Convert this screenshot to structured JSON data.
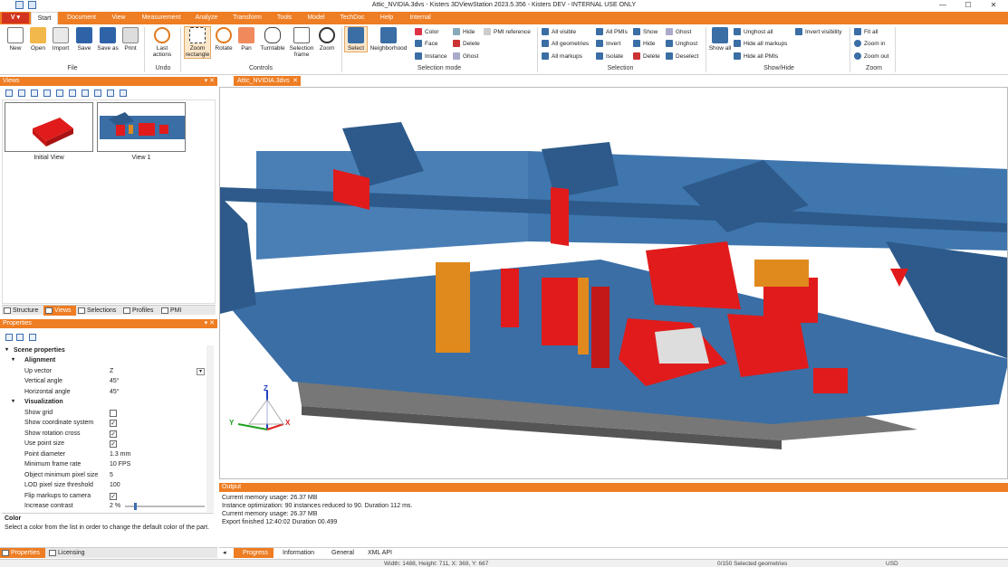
{
  "window": {
    "title": "Attic_NVIDIA.3dvs - Kisters 3DViewStation 2023.5.356 - Kisters DEV - INTERNAL USE ONLY",
    "controls": [
      "—",
      "☐",
      "✕"
    ]
  },
  "menu": {
    "app_button": "V",
    "tabs": [
      "Start",
      "Document",
      "View",
      "Measurement",
      "Analyze",
      "Transform",
      "Tools",
      "Model",
      "TechDoc",
      "Help",
      "Internal"
    ],
    "active_tab": "Start"
  },
  "ribbon": {
    "file": {
      "label": "File",
      "new": "New",
      "open": "Open",
      "import": "Import",
      "save": "Save",
      "save_as": "Save as",
      "print": "Print"
    },
    "undo": {
      "label": "Undo",
      "last_actions": "Last actions"
    },
    "controls": {
      "label": "Controls",
      "zoom_rectangle": "Zoom rectangle",
      "rotate": "Rotate",
      "pan": "Pan",
      "turntable": "Turntable",
      "selection_frame": "Selection frame",
      "zoom": "Zoom"
    },
    "selection_mode": {
      "label": "Selection mode",
      "select": "Select",
      "neighborhood": "Neighborhood",
      "color": "Color",
      "face": "Face",
      "instance": "Instance",
      "hide": "Hide",
      "delete": "Delete",
      "ghost": "Ghost",
      "pmi_reference": "PMI reference"
    },
    "selection": {
      "label": "Selection",
      "all_visible": "All visible",
      "all_geometries": "All geometries",
      "all_markups": "All markups",
      "all_pmis": "All PMIs",
      "invert": "Invert",
      "isolate": "Isolate",
      "show": "Show",
      "hide": "Hide",
      "delete": "Delete",
      "ghost": "Ghost",
      "unghost": "Unghost",
      "deselect": "Deselect"
    },
    "show_hide": {
      "label": "Show/Hide",
      "show_all": "Show all",
      "unghost_all": "Unghost all",
      "hide_all_markups": "Hide all markups",
      "hide_all_pmis": "Hide all PMIs",
      "invert_visibility": "Invert visibility"
    },
    "zoom_group": {
      "label": "Zoom",
      "fit_all": "Fit all",
      "zoom_in": "Zoom in",
      "zoom_out": "Zoom out"
    }
  },
  "views_panel": {
    "title": "Views",
    "thumbnails": [
      {
        "label": "Initial View"
      },
      {
        "label": "View 1"
      }
    ],
    "tabs": [
      "Structure",
      "Views",
      "Selections",
      "Profiles",
      "PMI"
    ],
    "active_tab": "Views"
  },
  "properties_panel": {
    "title": "Properties",
    "section": "Scene properties",
    "categories": {
      "alignment": "Alignment",
      "visualization": "Visualization"
    },
    "rows": {
      "up_vector": {
        "label": "Up vector",
        "value": "Z"
      },
      "vertical_angle": {
        "label": "Vertical angle",
        "value": "45°"
      },
      "horizontal_angle": {
        "label": "Horizontal angle",
        "value": "45°"
      },
      "show_grid": {
        "label": "Show grid",
        "checked": false
      },
      "show_coord": {
        "label": "Show coordinate system",
        "checked": true
      },
      "show_rot": {
        "label": "Show rotation cross",
        "checked": true
      },
      "use_point_size": {
        "label": "Use point size",
        "checked": true
      },
      "point_diameter": {
        "label": "Point diameter",
        "value": "1.3 mm"
      },
      "min_frame_rate": {
        "label": "Minimum frame rate",
        "value": "10 FPS"
      },
      "obj_min_px": {
        "label": "Object minimum pixel size",
        "value": "5"
      },
      "lod_px": {
        "label": "LOD pixel size threshold",
        "value": "100"
      },
      "flip_markups": {
        "label": "Flip markups to camera",
        "checked": true
      },
      "increase_contrast": {
        "label": "Increase contrast",
        "value": "2 %"
      }
    },
    "description": {
      "title": "Color",
      "text": "Select a color from the list in order to change the default color of the part."
    },
    "bottom_tabs": [
      "Properties",
      "Licensing"
    ],
    "active_bottom_tab": "Properties"
  },
  "document": {
    "tab": "Attic_NVIDIA.3dvs"
  },
  "output": {
    "title": "Output",
    "lines": [
      "Current memory usage: 26.37 MB",
      "Instance optimization: 90 instances reduced to 90. Duration 112 ms.",
      "Current memory usage: 26.37 MB",
      "Export finished 12:40:02 Duration 00.499"
    ],
    "tabs": [
      "Progress",
      "Information",
      "General",
      "XML API"
    ],
    "active_tab": "Progress"
  },
  "statusbar": {
    "dimensions": "Width: 1488, Height: 711, X: 369, Y: 667",
    "selected": "0/150 Selected geometries",
    "currency": "USD"
  },
  "axes": {
    "x": "X",
    "y": "Y",
    "z": "Z"
  },
  "colors": {
    "accent": "#ee7d23",
    "model_blue": "#3a6ea5",
    "model_red": "#e11b1b",
    "model_orange": "#e08a1e"
  }
}
